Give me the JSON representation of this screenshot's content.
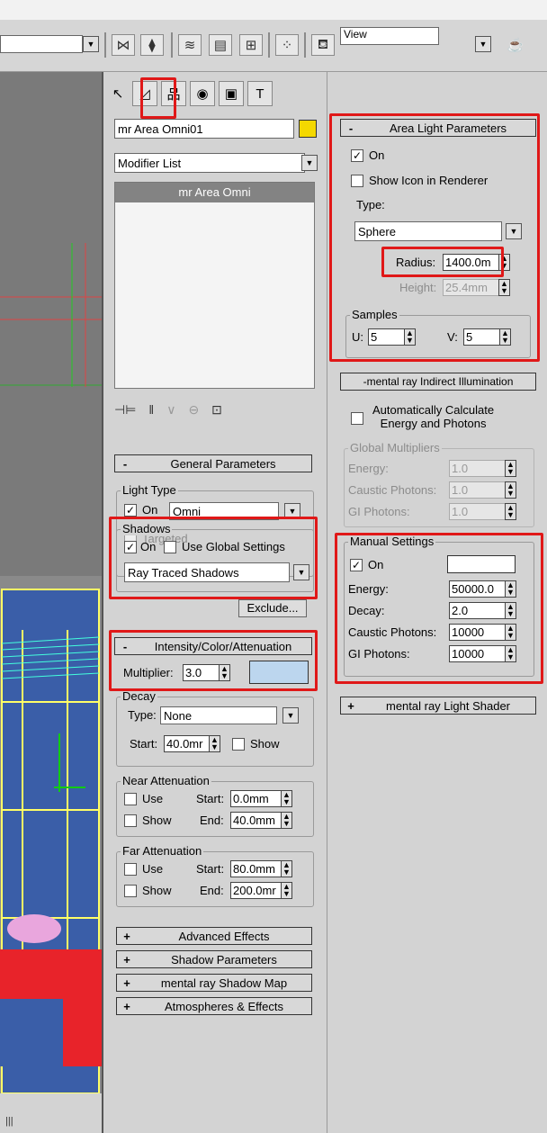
{
  "toolbar": {
    "view_label": "View",
    "icons": [
      "dropdown-arrow",
      "mirror-icon",
      "align-icon",
      "layers-icon",
      "curve-editor-icon",
      "schematic-icon",
      "material-editor-icon",
      "render-setup-icon",
      "teapot-icon"
    ]
  },
  "command_panel": {
    "tabs": [
      "create",
      "modify",
      "hierarchy",
      "motion",
      "display",
      "utilities"
    ],
    "object_name": "mr Area Omni01",
    "object_color": "#f4d800",
    "modifier_list_label": "Modifier List",
    "stack_item": "mr Area Omni",
    "general_parameters": {
      "title": "General Parameters",
      "sign": "-",
      "light_type_group": "Light Type",
      "on_label": "On",
      "on_checked": true,
      "type_value": "Omni",
      "targeted_label": "Targeted",
      "shadows_group": "Shadows",
      "shadows_on_label": "On",
      "use_global_label": "Use Global Settings",
      "shadow_type": "Ray Traced Shadows",
      "exclude_label": "Exclude..."
    },
    "intensity": {
      "title": "Intensity/Color/Attenuation",
      "sign": "-",
      "multiplier_label": "Multiplier:",
      "multiplier_value": "3.0",
      "light_color": "#bcd6ee",
      "decay_group": "Decay",
      "type_label": "Type:",
      "type_value": "None",
      "start_label": "Start:",
      "start_value": "40.0mr",
      "show_label": "Show",
      "near_group": "Near Attenuation",
      "near_use": "Use",
      "near_show": "Show",
      "near_start_label": "Start:",
      "near_start_value": "0.0mm",
      "near_end_label": "End:",
      "near_end_value": "40.0mm",
      "far_group": "Far Attenuation",
      "far_use": "Use",
      "far_show": "Show",
      "far_start_label": "Start:",
      "far_start_value": "80.0mm",
      "far_end_label": "End:",
      "far_end_value": "200.0mr"
    },
    "collapsed_rollouts": [
      {
        "sign": "+",
        "title": "Advanced Effects"
      },
      {
        "sign": "+",
        "title": "Shadow Parameters"
      },
      {
        "sign": "+",
        "title": "mental ray Shadow Map"
      },
      {
        "sign": "+",
        "title": "Atmospheres & Effects"
      }
    ]
  },
  "area_light": {
    "title": "Area Light Parameters",
    "sign": "-",
    "on_label": "On",
    "on_checked": true,
    "show_icon_label": "Show Icon in Renderer",
    "type_label": "Type:",
    "type_value": "Sphere",
    "radius_label": "Radius:",
    "radius_value": "1400.0m",
    "height_label": "Height:",
    "height_value": "25.4mm",
    "samples_group": "Samples",
    "u_label": "U:",
    "u_value": "5",
    "v_label": "V:",
    "v_value": "5"
  },
  "indirect": {
    "title": "mental ray Indirect Illumination",
    "sign": "-",
    "auto_calc_label_1": "Automatically Calculate",
    "auto_calc_label_2": "Energy and Photons",
    "global_group": "Global Multipliers",
    "energy_label": "Energy:",
    "energy_value": "1.0",
    "caustic_label": "Caustic Photons:",
    "caustic_value": "1.0",
    "gi_label": "GI Photons:",
    "gi_value": "1.0",
    "manual_group": "Manual Settings",
    "manual_on_label": "On",
    "manual_color": "#ffffff",
    "m_energy_label": "Energy:",
    "m_energy_value": "50000.0",
    "decay_label": "Decay:",
    "decay_value": "2.0",
    "m_caustic_label": "Caustic Photons:",
    "m_caustic_value": "10000",
    "m_gi_label": "GI Photons:",
    "m_gi_value": "10000"
  },
  "light_shader": {
    "sign": "+",
    "title": "mental ray Light Shader"
  },
  "viewport": {
    "bottom_label": "|||"
  }
}
